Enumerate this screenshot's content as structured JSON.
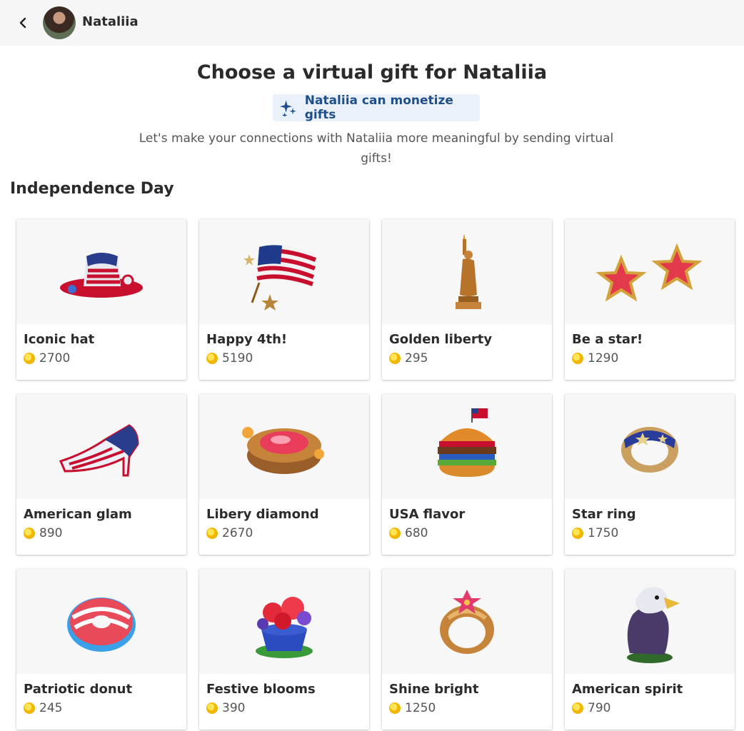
{
  "header": {
    "name": "Nataliia"
  },
  "title": "Choose a virtual gift for Nataliia",
  "monetize_badge": "Nataliia can monetize gifts",
  "subtitle": "Let's make your connections with Nataliia more meaningful by sending virtual gifts!",
  "section": "Independence Day",
  "gifts": [
    {
      "name": "Iconic hat",
      "price": "2700",
      "icon": "hat-icon"
    },
    {
      "name": "Happy 4th!",
      "price": "5190",
      "icon": "flag-icon"
    },
    {
      "name": "Golden liberty",
      "price": "295",
      "icon": "statue-icon"
    },
    {
      "name": "Be a star!",
      "price": "1290",
      "icon": "star-earrings-icon"
    },
    {
      "name": "American glam",
      "price": "890",
      "icon": "shoe-icon"
    },
    {
      "name": "Libery diamond",
      "price": "2670",
      "icon": "diamond-icon"
    },
    {
      "name": "USA flavor",
      "price": "680",
      "icon": "burger-icon"
    },
    {
      "name": "Star ring",
      "price": "1750",
      "icon": "star-ring-icon"
    },
    {
      "name": "Patriotic donut",
      "price": "245",
      "icon": "donut-icon"
    },
    {
      "name": "Festive blooms",
      "price": "390",
      "icon": "flowers-icon"
    },
    {
      "name": "Shine bright",
      "price": "1250",
      "icon": "gold-ring-icon"
    },
    {
      "name": "American spirit",
      "price": "790",
      "icon": "eagle-icon"
    }
  ]
}
